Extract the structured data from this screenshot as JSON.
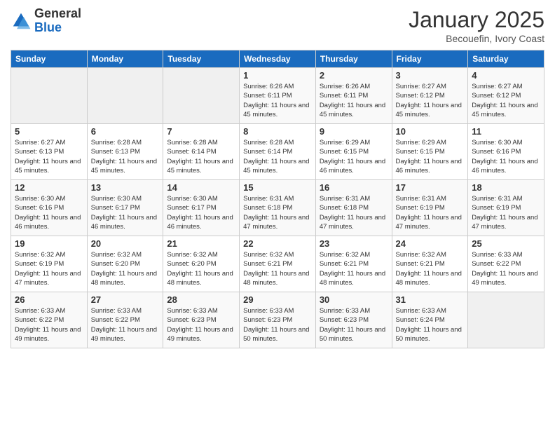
{
  "logo": {
    "general": "General",
    "blue": "Blue"
  },
  "header": {
    "month": "January 2025",
    "location": "Becouefin, Ivory Coast"
  },
  "weekdays": [
    "Sunday",
    "Monday",
    "Tuesday",
    "Wednesday",
    "Thursday",
    "Friday",
    "Saturday"
  ],
  "weeks": [
    [
      {
        "day": "",
        "info": ""
      },
      {
        "day": "",
        "info": ""
      },
      {
        "day": "",
        "info": ""
      },
      {
        "day": "1",
        "info": "Sunrise: 6:26 AM\nSunset: 6:11 PM\nDaylight: 11 hours and 45 minutes."
      },
      {
        "day": "2",
        "info": "Sunrise: 6:26 AM\nSunset: 6:11 PM\nDaylight: 11 hours and 45 minutes."
      },
      {
        "day": "3",
        "info": "Sunrise: 6:27 AM\nSunset: 6:12 PM\nDaylight: 11 hours and 45 minutes."
      },
      {
        "day": "4",
        "info": "Sunrise: 6:27 AM\nSunset: 6:12 PM\nDaylight: 11 hours and 45 minutes."
      }
    ],
    [
      {
        "day": "5",
        "info": "Sunrise: 6:27 AM\nSunset: 6:13 PM\nDaylight: 11 hours and 45 minutes."
      },
      {
        "day": "6",
        "info": "Sunrise: 6:28 AM\nSunset: 6:13 PM\nDaylight: 11 hours and 45 minutes."
      },
      {
        "day": "7",
        "info": "Sunrise: 6:28 AM\nSunset: 6:14 PM\nDaylight: 11 hours and 45 minutes."
      },
      {
        "day": "8",
        "info": "Sunrise: 6:28 AM\nSunset: 6:14 PM\nDaylight: 11 hours and 45 minutes."
      },
      {
        "day": "9",
        "info": "Sunrise: 6:29 AM\nSunset: 6:15 PM\nDaylight: 11 hours and 46 minutes."
      },
      {
        "day": "10",
        "info": "Sunrise: 6:29 AM\nSunset: 6:15 PM\nDaylight: 11 hours and 46 minutes."
      },
      {
        "day": "11",
        "info": "Sunrise: 6:30 AM\nSunset: 6:16 PM\nDaylight: 11 hours and 46 minutes."
      }
    ],
    [
      {
        "day": "12",
        "info": "Sunrise: 6:30 AM\nSunset: 6:16 PM\nDaylight: 11 hours and 46 minutes."
      },
      {
        "day": "13",
        "info": "Sunrise: 6:30 AM\nSunset: 6:17 PM\nDaylight: 11 hours and 46 minutes."
      },
      {
        "day": "14",
        "info": "Sunrise: 6:30 AM\nSunset: 6:17 PM\nDaylight: 11 hours and 46 minutes."
      },
      {
        "day": "15",
        "info": "Sunrise: 6:31 AM\nSunset: 6:18 PM\nDaylight: 11 hours and 47 minutes."
      },
      {
        "day": "16",
        "info": "Sunrise: 6:31 AM\nSunset: 6:18 PM\nDaylight: 11 hours and 47 minutes."
      },
      {
        "day": "17",
        "info": "Sunrise: 6:31 AM\nSunset: 6:19 PM\nDaylight: 11 hours and 47 minutes."
      },
      {
        "day": "18",
        "info": "Sunrise: 6:31 AM\nSunset: 6:19 PM\nDaylight: 11 hours and 47 minutes."
      }
    ],
    [
      {
        "day": "19",
        "info": "Sunrise: 6:32 AM\nSunset: 6:19 PM\nDaylight: 11 hours and 47 minutes."
      },
      {
        "day": "20",
        "info": "Sunrise: 6:32 AM\nSunset: 6:20 PM\nDaylight: 11 hours and 48 minutes."
      },
      {
        "day": "21",
        "info": "Sunrise: 6:32 AM\nSunset: 6:20 PM\nDaylight: 11 hours and 48 minutes."
      },
      {
        "day": "22",
        "info": "Sunrise: 6:32 AM\nSunset: 6:21 PM\nDaylight: 11 hours and 48 minutes."
      },
      {
        "day": "23",
        "info": "Sunrise: 6:32 AM\nSunset: 6:21 PM\nDaylight: 11 hours and 48 minutes."
      },
      {
        "day": "24",
        "info": "Sunrise: 6:32 AM\nSunset: 6:21 PM\nDaylight: 11 hours and 48 minutes."
      },
      {
        "day": "25",
        "info": "Sunrise: 6:33 AM\nSunset: 6:22 PM\nDaylight: 11 hours and 49 minutes."
      }
    ],
    [
      {
        "day": "26",
        "info": "Sunrise: 6:33 AM\nSunset: 6:22 PM\nDaylight: 11 hours and 49 minutes."
      },
      {
        "day": "27",
        "info": "Sunrise: 6:33 AM\nSunset: 6:22 PM\nDaylight: 11 hours and 49 minutes."
      },
      {
        "day": "28",
        "info": "Sunrise: 6:33 AM\nSunset: 6:23 PM\nDaylight: 11 hours and 49 minutes."
      },
      {
        "day": "29",
        "info": "Sunrise: 6:33 AM\nSunset: 6:23 PM\nDaylight: 11 hours and 50 minutes."
      },
      {
        "day": "30",
        "info": "Sunrise: 6:33 AM\nSunset: 6:23 PM\nDaylight: 11 hours and 50 minutes."
      },
      {
        "day": "31",
        "info": "Sunrise: 6:33 AM\nSunset: 6:24 PM\nDaylight: 11 hours and 50 minutes."
      },
      {
        "day": "",
        "info": ""
      }
    ]
  ]
}
